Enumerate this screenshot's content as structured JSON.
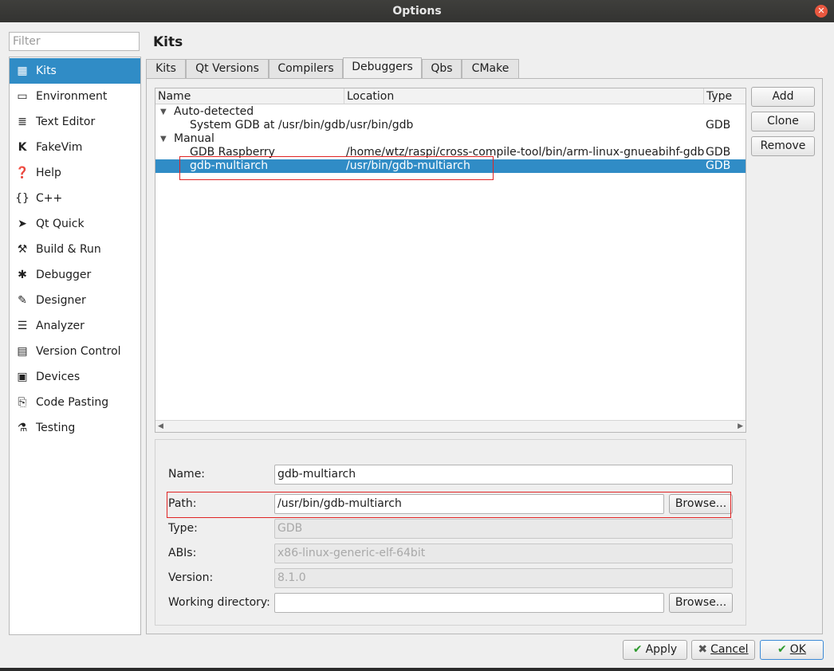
{
  "window": {
    "title": "Options"
  },
  "filter": {
    "placeholder": "Filter"
  },
  "sidebar": {
    "items": [
      {
        "label": "Kits",
        "icon": "kits-icon"
      },
      {
        "label": "Environment",
        "icon": "monitor-icon"
      },
      {
        "label": "Text Editor",
        "icon": "text-editor-icon"
      },
      {
        "label": "FakeVim",
        "icon": "fakevim-icon"
      },
      {
        "label": "Help",
        "icon": "help-icon"
      },
      {
        "label": "C++",
        "icon": "braces-icon"
      },
      {
        "label": "Qt Quick",
        "icon": "qtquick-icon"
      },
      {
        "label": "Build & Run",
        "icon": "hammer-icon"
      },
      {
        "label": "Debugger",
        "icon": "bug-icon"
      },
      {
        "label": "Designer",
        "icon": "pencil-icon"
      },
      {
        "label": "Analyzer",
        "icon": "analyzer-icon"
      },
      {
        "label": "Version Control",
        "icon": "version-control-icon"
      },
      {
        "label": "Devices",
        "icon": "devices-icon"
      },
      {
        "label": "Code Pasting",
        "icon": "paste-icon"
      },
      {
        "label": "Testing",
        "icon": "flask-icon"
      }
    ]
  },
  "page": {
    "title": "Kits"
  },
  "tabs": [
    "Kits",
    "Qt Versions",
    "Compilers",
    "Debuggers",
    "Qbs",
    "CMake"
  ],
  "tree": {
    "headers": {
      "name": "Name",
      "location": "Location",
      "type": "Type"
    },
    "groups": {
      "auto": "Auto-detected",
      "manual": "Manual"
    },
    "rows": {
      "system_gdb": {
        "name": "System GDB at /usr/bin/gdb",
        "location": "/usr/bin/gdb",
        "type": "GDB"
      },
      "gdb_raspberry": {
        "name": "GDB Raspberry",
        "location": "/home/wtz/raspi/cross-compile-tool/bin/arm-linux-gnueabihf-gdb",
        "type": "GDB"
      },
      "gdb_multiarch": {
        "name": "gdb-multiarch",
        "location": "/usr/bin/gdb-multiarch",
        "type": "GDB"
      }
    }
  },
  "side_buttons": {
    "add": "Add",
    "clone": "Clone",
    "remove": "Remove"
  },
  "details": {
    "name_label": "Name:",
    "name_value": "gdb-multiarch",
    "path_label": "Path:",
    "path_value": "/usr/bin/gdb-multiarch",
    "browse_label": "Browse...",
    "type_label": "Type:",
    "type_value": "GDB",
    "abis_label": "ABIs:",
    "abis_value": "x86-linux-generic-elf-64bit",
    "version_label": "Version:",
    "version_value": "8.1.0",
    "workdir_label": "Working directory:",
    "workdir_value": ""
  },
  "footer": {
    "apply": "Apply",
    "cancel": "Cancel",
    "ok": "OK"
  },
  "colors": {
    "selection": "#308cc6",
    "highlight_box": "#e02424"
  }
}
